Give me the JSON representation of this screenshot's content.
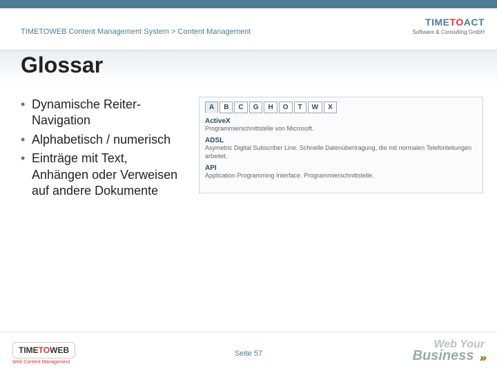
{
  "breadcrumb": "TIMETOWEB Content Management System > Content Management",
  "title": "Glossar",
  "bullets": [
    "Dynamische Reiter-Navigation",
    "Alphabetisch / numerisch",
    "Einträge mit Text, Anhängen oder Verweisen auf andere Dokumente"
  ],
  "tabs": [
    "A",
    "B",
    "C",
    "G",
    "H",
    "O",
    "T",
    "W",
    "X"
  ],
  "active_tab": "A",
  "entries": [
    {
      "term": "ActiveX",
      "desc": "Programmierschnittstelle von Microsoft."
    },
    {
      "term": "ADSL",
      "desc": "Asymetric Digital Subscriber Line. Schnelle Datenübertragung, die mit normalen Telefonleitungen arbeitet."
    },
    {
      "term": "API",
      "desc": "Application Programming Interface. Programmierschnittstelle."
    }
  ],
  "page_label": "Seite 57",
  "logo_top": {
    "brand_a": "TIME",
    "brand_b": "TO",
    "brand_c": "ACT",
    "sub": "Software & Consulting GmbH"
  },
  "logo_bl": {
    "a": "TIME",
    "b": "TO",
    "c": "WEB",
    "sub": "Web Content Management"
  },
  "logo_br": {
    "line1": "Web Your",
    "line2": "Business"
  }
}
